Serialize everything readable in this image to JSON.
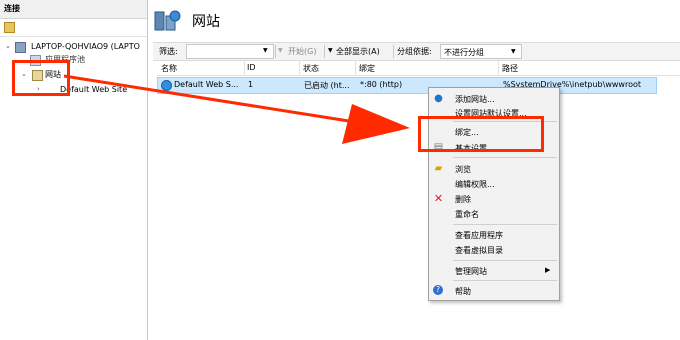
{
  "left_pane": {
    "header": "连接",
    "tree": {
      "computer": "LAPTOP-QOHVIAO9 (LAPTO",
      "app_pools": "应用程序池",
      "sites": "网站",
      "default_site": "Default Web Site"
    }
  },
  "main": {
    "title": "网站",
    "toolbar": {
      "filter_label": "筛选:",
      "start": "开始(G)",
      "show_all": "全部显示(A)",
      "group_label": "分组依据:",
      "group_value": "不进行分组"
    },
    "columns": [
      "名称",
      "ID",
      "状态",
      "绑定",
      "路径"
    ],
    "rows": [
      {
        "name": "Default Web S...",
        "id": "1",
        "status": "已启动 (ht...",
        "binding": "*:80 (http)",
        "path": "%SystemDrive%\\inetpub\\wwwroot"
      }
    ]
  },
  "context_menu": {
    "items": [
      {
        "label": "添加网站...",
        "icon": "globe-add-icon"
      },
      {
        "label": "设置网站默认设置...",
        "icon": ""
      },
      {
        "label": "绑定...",
        "icon": ""
      },
      {
        "label": "基本设置...",
        "icon": "settings-icon"
      },
      {
        "label": "浏览",
        "icon": "folder-icon"
      },
      {
        "label": "编辑权限...",
        "icon": ""
      },
      {
        "label": "删除",
        "icon": "delete-x-icon"
      },
      {
        "label": "重命名",
        "icon": ""
      },
      {
        "label": "查看应用程序",
        "icon": ""
      },
      {
        "label": "查看虚拟目录",
        "icon": ""
      },
      {
        "label": "管理网站",
        "icon": "submenu-arrow-icon"
      },
      {
        "label": "帮助",
        "icon": "help-icon"
      }
    ]
  },
  "colors": {
    "annotation_red": "#ff2a00",
    "selection_fill": "#cce8ff",
    "selection_border": "#99d1ff"
  }
}
